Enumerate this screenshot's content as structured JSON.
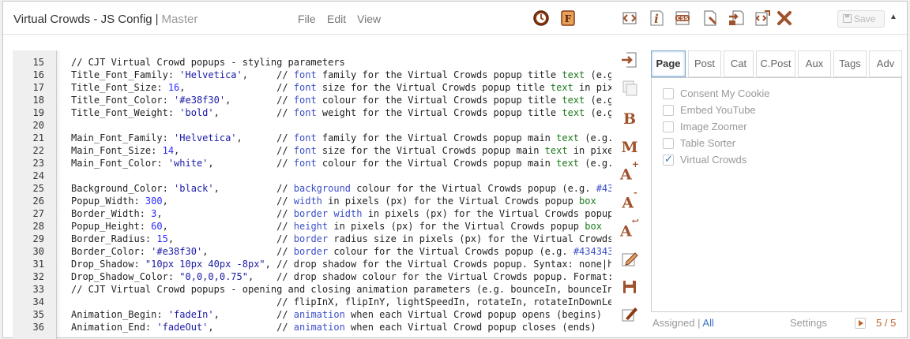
{
  "header": {
    "title": "Virtual Crowds - JS Config",
    "separator": "|",
    "branch": "Master",
    "menus": [
      "File",
      "Edit",
      "View"
    ],
    "save_label": "Save"
  },
  "editor": {
    "lines": [
      {
        "n": "15",
        "t": "// CJT Virtual Crowd popups - styling parameters"
      },
      {
        "n": "16",
        "t": "Title_Font_Family: 'Helvetica',     // font family for the Virtual Crowds popup title text (e.g"
      },
      {
        "n": "17",
        "t": "Title_Font_Size: 16,                // font size for the Virtual Crowds popup title text in pix"
      },
      {
        "n": "18",
        "t": "Title_Font_Color: '#e38f30',        // font colour for the Virtual Crowds popup title text (e.g"
      },
      {
        "n": "19",
        "t": "Title_Font_Weight: 'bold',          // font weight for the Virtual Crowds popup title text (e.g"
      },
      {
        "n": "20",
        "t": ""
      },
      {
        "n": "21",
        "t": "Main_Font_Family: 'Helvetica',      // font family for the Virtual Crowds popup main text (e.g."
      },
      {
        "n": "22",
        "t": "Main_Font_Size: 14,                 // font size for the Virtual Crowds popup main text in pixe"
      },
      {
        "n": "23",
        "t": "Main_Font_Color: 'white',           // font colour for the Virtual Crowds popup main text (e.g."
      },
      {
        "n": "24",
        "t": ""
      },
      {
        "n": "25",
        "t": "Background_Color: 'black',          // background colour for the Virtual Crowds popup (e.g. #43"
      },
      {
        "n": "26",
        "t": "Popup_Width: 300,                   // width in pixels (px) for the Virtual Crowds popup box"
      },
      {
        "n": "27",
        "t": "Border_Width: 3,                    // border width in pixels (px) for the Virtual Crowds popup"
      },
      {
        "n": "28",
        "t": "Popup_Height: 60,                   // height in pixels (px) for the Virtual Crowds popup box"
      },
      {
        "n": "29",
        "t": "Border_Radius: 15,                  // border radius size in pixels (px) for the Virtual Crowds"
      },
      {
        "n": "30",
        "t": "Border_Color: '#e38f30',            // border colour for the Virtual Crowds popup (e.g. #434343"
      },
      {
        "n": "31",
        "t": "Drop_Shadow: \"10px 10px 40px -8px\", // drop shadow for the Virtual Crowds popup. Syntax: none|h"
      },
      {
        "n": "32",
        "t": "Drop_Shadow_Color: \"0,0,0,0.75\",    // drop shadow colour for the Virtual Crowds popup. Format:"
      },
      {
        "n": "33",
        "t": "// CJT Virtual Crowd popups - opening and closing animation parameters (e.g. bounceIn, bounceIn"
      },
      {
        "n": "34",
        "t": "                                    // flipInX, flipInY, lightSpeedIn, rotateIn, rotateInDownLe"
      },
      {
        "n": "35",
        "t": "Animation_Begin: 'fadeIn',          // animation when each Virtual Crowd popup opens (begins)"
      },
      {
        "n": "36",
        "t": "Animation_End: 'fadeOut',           // animation when each Virtual Crowd popup closes (ends)"
      }
    ]
  },
  "toolbar": {
    "header_icons": [
      "history-icon",
      "file-f-icon",
      "code-tag-icon",
      "info-icon",
      "css-icon",
      "file-pin-icon",
      "file-export-icon",
      "code-export-icon",
      "close-x-icon"
    ],
    "side_icons": [
      "import-icon",
      "copy-icon",
      "bold-b-icon",
      "bold-m-icon",
      "font-increase-icon",
      "font-decrease-icon",
      "font-reset-icon",
      "edit-pencil-icon",
      "save-disk-icon",
      "brush-icon"
    ],
    "letters": {
      "b": "B",
      "m": "M",
      "a": "A",
      "plus": "+",
      "minus": "-",
      "reset": "↩"
    }
  },
  "sidebar": {
    "tabs": [
      "Page",
      "Post",
      "Cat",
      "C.Post",
      "Aux",
      "Tags",
      "Adv"
    ],
    "active_tab": "Page",
    "plugins": [
      {
        "label": "Consent My Cookie",
        "checked": false
      },
      {
        "label": "Embed YouTube",
        "checked": false
      },
      {
        "label": "Image Zoomer",
        "checked": false
      },
      {
        "label": "Table Sorter",
        "checked": false
      },
      {
        "label": "Virtual Crowds",
        "checked": true
      }
    ],
    "footer": {
      "assigned": "Assigned",
      "sep": "|",
      "all": "All",
      "settings": "Settings",
      "pager": "5 / 5"
    }
  },
  "colors": {
    "accent": "#a0522d",
    "link": "#3b72c4",
    "pager": "#c0632a"
  }
}
